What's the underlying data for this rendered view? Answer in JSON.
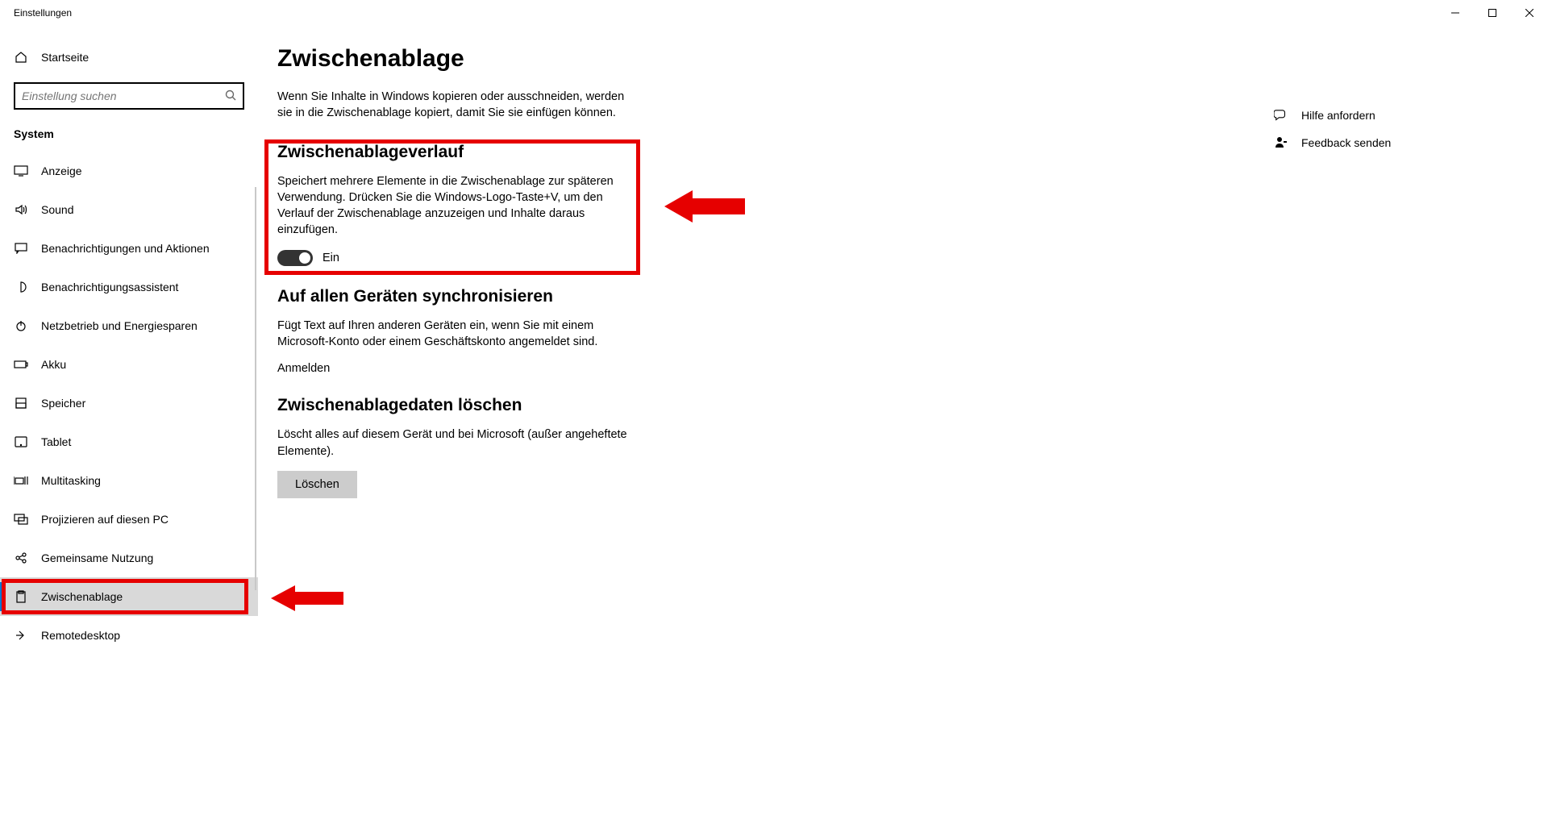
{
  "window": {
    "title": "Einstellungen"
  },
  "sidebar": {
    "home": "Startseite",
    "search_placeholder": "Einstellung suchen",
    "category": "System",
    "items": [
      {
        "label": "Anzeige"
      },
      {
        "label": "Sound"
      },
      {
        "label": "Benachrichtigungen und Aktionen"
      },
      {
        "label": "Benachrichtigungsassistent"
      },
      {
        "label": "Netzbetrieb und Energiesparen"
      },
      {
        "label": "Akku"
      },
      {
        "label": "Speicher"
      },
      {
        "label": "Tablet"
      },
      {
        "label": "Multitasking"
      },
      {
        "label": "Projizieren auf diesen PC"
      },
      {
        "label": "Gemeinsame Nutzung"
      },
      {
        "label": "Zwischenablage"
      },
      {
        "label": "Remotedesktop"
      }
    ]
  },
  "page": {
    "title": "Zwischenablage",
    "intro": "Wenn Sie Inhalte in Windows kopieren oder ausschneiden, werden sie in die Zwischenablage kopiert, damit Sie sie einfügen können.",
    "sections": {
      "history": {
        "heading": "Zwischenablageverlauf",
        "desc": "Speichert mehrere Elemente in die Zwischenablage zur späteren Verwendung. Drücken Sie die Windows-Logo-Taste+V, um den Verlauf der Zwischenablage anzuzeigen und Inhalte daraus einzufügen.",
        "toggle_state": "Ein"
      },
      "sync": {
        "heading": "Auf allen Geräten synchronisieren",
        "desc": "Fügt Text auf Ihren anderen Geräten ein, wenn Sie mit einem Microsoft-Konto oder einem Geschäftskonto angemeldet sind.",
        "link": "Anmelden"
      },
      "clear": {
        "heading": "Zwischenablagedaten löschen",
        "desc": "Löscht alles auf diesem Gerät und bei Microsoft (außer angeheftete Elemente).",
        "button": "Löschen"
      }
    }
  },
  "aside": {
    "help": "Hilfe anfordern",
    "feedback": "Feedback senden"
  }
}
